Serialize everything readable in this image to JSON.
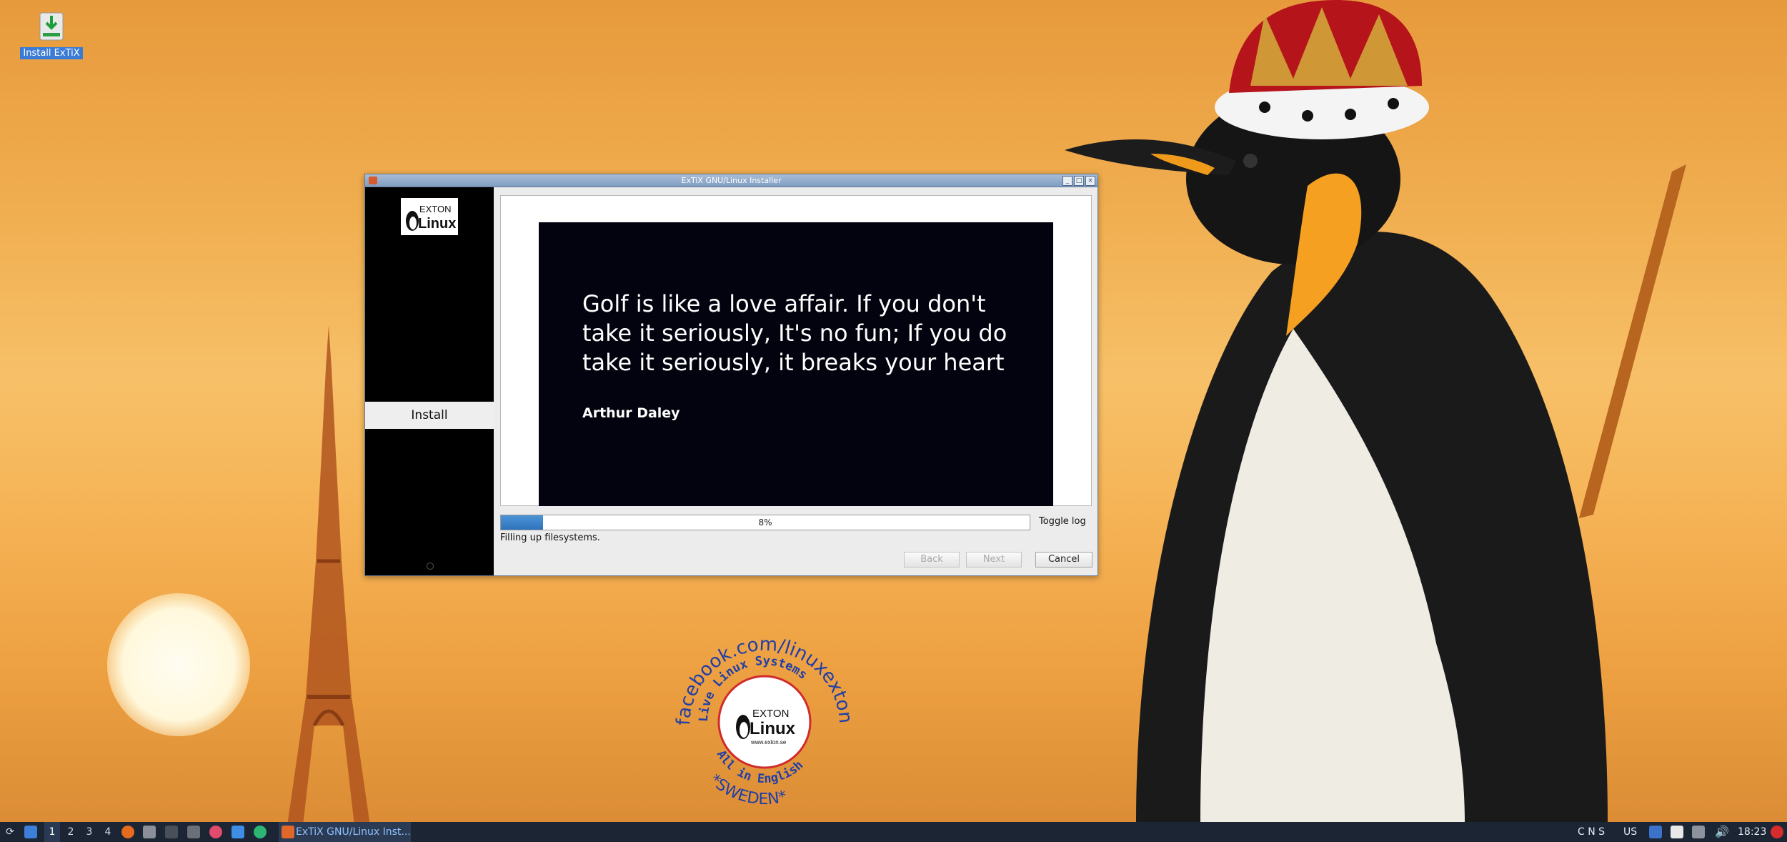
{
  "desktop": {
    "icons": [
      {
        "label": "Install ExTiX",
        "icon": "install-download-icon"
      }
    ],
    "badge": {
      "top_text": "facebook.com/linuxexton",
      "ring_text": "Live Linux Systems",
      "bottom_text": "All in English",
      "footer_text": "*SWEDEN*",
      "logo_line1": "EXTON",
      "logo_line2": "Linux",
      "url": "www.exton.se"
    }
  },
  "window": {
    "title": "ExTiX GNU/Linux Installer",
    "sidebar": {
      "logo_line1": "EXTON",
      "logo_line2": "Linux",
      "items": [
        {
          "label": "Install",
          "active": true
        }
      ]
    },
    "slide": {
      "quote": "Golf is like a love affair. If you don't take it seriously, It's no fun; If you do take it seriously, it breaks your heart",
      "author": "Arthur Daley"
    },
    "progress": {
      "value": 0.08,
      "label": "8%"
    },
    "toggle_log": "Toggle log",
    "status": "Filling up filesystems.",
    "buttons": {
      "back": "Back",
      "next": "Next",
      "cancel": "Cancel"
    }
  },
  "taskbar": {
    "workspaces": [
      "1",
      "2",
      "3",
      "4"
    ],
    "active_workspace": "1",
    "task_label": "ExTiX GNU/Linux Inst...",
    "tray": {
      "indicators": "C N S",
      "keyboard": "US",
      "clock": "18:23"
    }
  }
}
